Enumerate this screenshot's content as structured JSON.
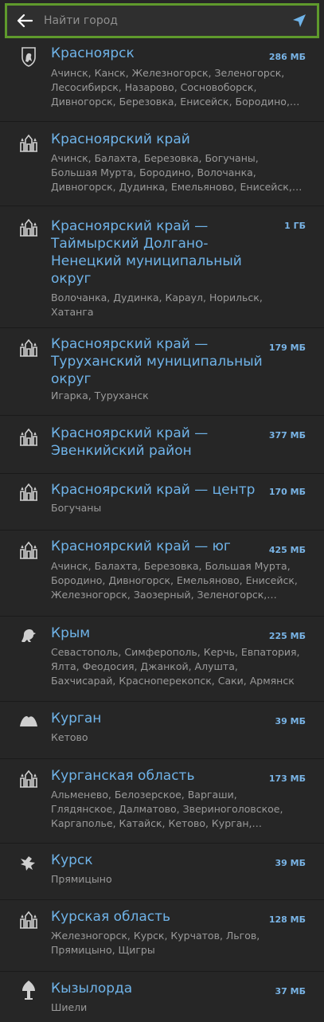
{
  "search": {
    "placeholder": "Найти город"
  },
  "regions": [
    {
      "name": "Красноярск",
      "size": "286 МБ",
      "icon": "lion-crest-icon",
      "cities": "Ачинск, Канск, Железногорск, Зеленогорск, Лесосибирск, Назарово, Сосновоборск, Дивногорск, Березовка, Енисейск, Бородино, Заозерный, Ужур"
    },
    {
      "name": "Красноярский край",
      "size": "",
      "icon": "building-icon",
      "cities": "Ачинск, Балахта, Березовка, Богучаны, Большая Мурта, Бородино, Волочанка, Дивногорск, Дудинка, Емельяново, Енисейск, Ермаковское"
    },
    {
      "name": "Красноярский край — Таймырский Долгано-Ненецкий муниципальный округ",
      "size": "1 ГБ",
      "icon": "building-icon",
      "cities": "Волочанка, Дудинка, Караул, Норильск, Хатанга"
    },
    {
      "name": "Красноярский край — Туруханский муниципальный округ",
      "size": "179 МБ",
      "icon": "building-icon",
      "cities": "Игарка, Туруханск"
    },
    {
      "name": "Красноярский край — Эвенкийский район",
      "size": "377 МБ",
      "icon": "building-icon",
      "cities": ""
    },
    {
      "name": "Красноярский край — центр",
      "size": "170 МБ",
      "icon": "building-icon",
      "cities": "Богучаны"
    },
    {
      "name": "Красноярский край — юг",
      "size": "425 МБ",
      "icon": "building-icon",
      "cities": "Ачинск, Балахта, Березовка, Большая Мурта, Бородино, Дивногорск, Емельяново, Енисейск, Железногорск, Заозерный, Зеленогорск, Казачинское"
    },
    {
      "name": "Крым",
      "size": "225 МБ",
      "icon": "griffin-icon",
      "cities": "Севастополь, Симферополь, Керчь, Евпатория, Ялта, Феодосия, Джанкой, Алушта, Бахчисарай, Красноперекопск, Саки, Армянск"
    },
    {
      "name": "Курган",
      "size": "39 МБ",
      "icon": "mound-icon",
      "cities": "Кетово"
    },
    {
      "name": "Курганская область",
      "size": "173 МБ",
      "icon": "building-icon",
      "cities": "Альменево, Белозерское, Варгаши, Глядянское, Далматово, Звериноголовское, Каргаполье, Катайск, Кетово, Курган, Куртамыш"
    },
    {
      "name": "Курск",
      "size": "39 МБ",
      "icon": "bird-icon",
      "cities": "Прямицыно"
    },
    {
      "name": "Курская область",
      "size": "128 МБ",
      "icon": "building-icon",
      "cities": "Железногорск, Курск, Курчатов, Льгов, Прямицыно, Щигры"
    },
    {
      "name": "Кызылорда",
      "size": "37 МБ",
      "icon": "monument-icon",
      "cities": "Шиели"
    }
  ]
}
